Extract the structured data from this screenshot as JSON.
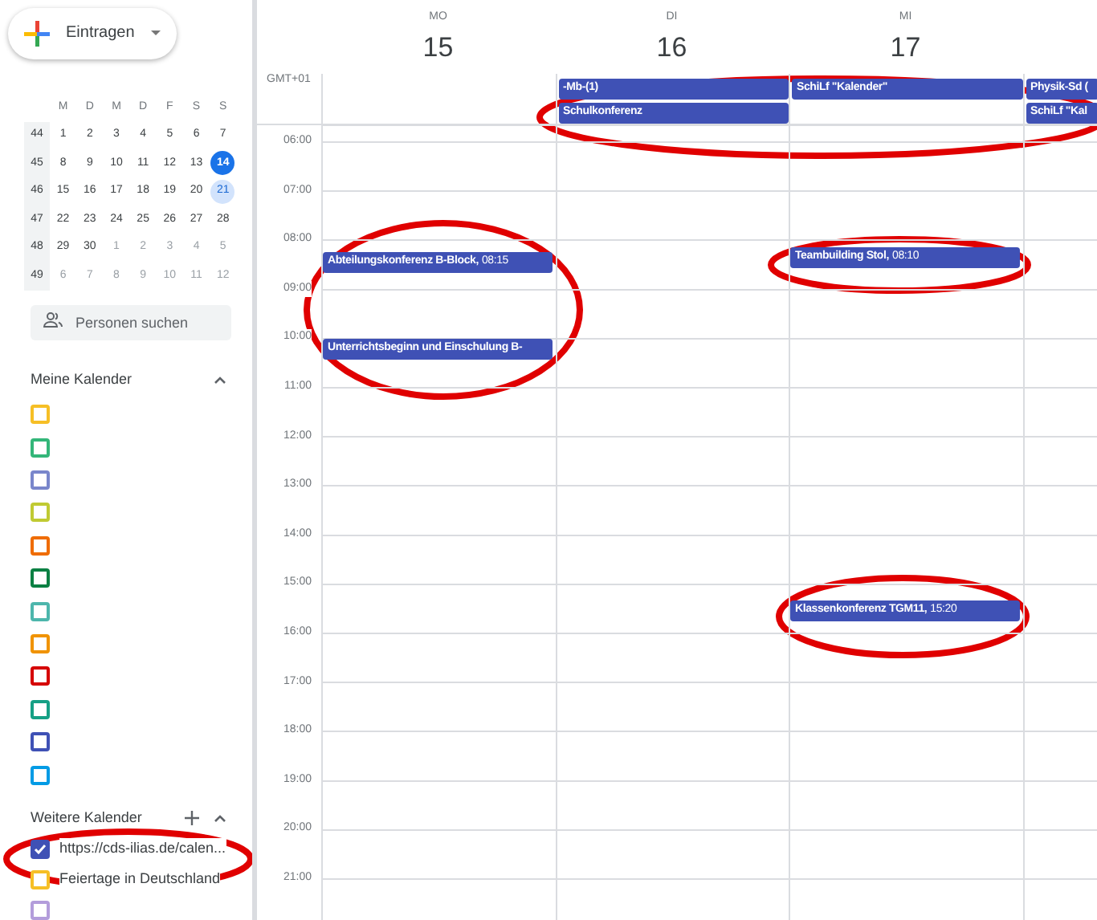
{
  "create_button": {
    "label": "Eintragen"
  },
  "mini_calendar": {
    "weekdays": [
      "M",
      "D",
      "M",
      "D",
      "F",
      "S",
      "S"
    ],
    "weeks": [
      {
        "number": "44",
        "days": [
          {
            "label": "1",
            "kind": "current"
          },
          {
            "label": "2",
            "kind": "current"
          },
          {
            "label": "3",
            "kind": "current"
          },
          {
            "label": "4",
            "kind": "current"
          },
          {
            "label": "5",
            "kind": "current"
          },
          {
            "label": "6",
            "kind": "current"
          },
          {
            "label": "7",
            "kind": "current"
          }
        ]
      },
      {
        "number": "45",
        "days": [
          {
            "label": "8",
            "kind": "current"
          },
          {
            "label": "9",
            "kind": "current"
          },
          {
            "label": "10",
            "kind": "current"
          },
          {
            "label": "11",
            "kind": "current"
          },
          {
            "label": "12",
            "kind": "current"
          },
          {
            "label": "13",
            "kind": "current"
          },
          {
            "label": "14",
            "kind": "today"
          }
        ]
      },
      {
        "number": "46",
        "days": [
          {
            "label": "15",
            "kind": "current"
          },
          {
            "label": "16",
            "kind": "current"
          },
          {
            "label": "17",
            "kind": "current"
          },
          {
            "label": "18",
            "kind": "current"
          },
          {
            "label": "19",
            "kind": "current"
          },
          {
            "label": "20",
            "kind": "current"
          },
          {
            "label": "21",
            "kind": "selected"
          }
        ]
      },
      {
        "number": "47",
        "days": [
          {
            "label": "22",
            "kind": "current"
          },
          {
            "label": "23",
            "kind": "current"
          },
          {
            "label": "24",
            "kind": "current"
          },
          {
            "label": "25",
            "kind": "current"
          },
          {
            "label": "26",
            "kind": "current"
          },
          {
            "label": "27",
            "kind": "current"
          },
          {
            "label": "28",
            "kind": "current"
          }
        ]
      },
      {
        "number": "48",
        "days": [
          {
            "label": "29",
            "kind": "current"
          },
          {
            "label": "30",
            "kind": "current"
          },
          {
            "label": "1",
            "kind": "other"
          },
          {
            "label": "2",
            "kind": "other"
          },
          {
            "label": "3",
            "kind": "other"
          },
          {
            "label": "4",
            "kind": "other"
          },
          {
            "label": "5",
            "kind": "other"
          }
        ]
      },
      {
        "number": "49",
        "days": [
          {
            "label": "6",
            "kind": "other"
          },
          {
            "label": "7",
            "kind": "other"
          },
          {
            "label": "8",
            "kind": "other"
          },
          {
            "label": "9",
            "kind": "other"
          },
          {
            "label": "10",
            "kind": "other"
          },
          {
            "label": "11",
            "kind": "other"
          },
          {
            "label": "12",
            "kind": "other"
          }
        ]
      }
    ]
  },
  "people_search": {
    "placeholder": "Personen suchen"
  },
  "my_calendars": {
    "title": "Meine Kalender",
    "items": [
      {
        "checked": false,
        "color": "#f6bf26"
      },
      {
        "checked": false,
        "color": "#33b679"
      },
      {
        "checked": false,
        "color": "#7986cb"
      },
      {
        "checked": false,
        "color": "#c0ca33"
      },
      {
        "checked": false,
        "color": "#ef6c00"
      },
      {
        "checked": false,
        "color": "#0b8043"
      },
      {
        "checked": false,
        "color": "#4db6ac"
      },
      {
        "checked": false,
        "color": "#f09300"
      },
      {
        "checked": false,
        "color": "#d50000"
      },
      {
        "checked": false,
        "color": "#16a085"
      },
      {
        "checked": false,
        "color": "#3f51b5"
      },
      {
        "checked": false,
        "color": "#039be5"
      }
    ]
  },
  "other_calendars": {
    "title": "Weitere Kalender",
    "items": [
      {
        "label": "https://cds-ilias.de/calen...",
        "checked": true,
        "color": "#3f51b5"
      },
      {
        "label": "Feiertage in Deutschland",
        "checked": false,
        "color": "#f6bf26"
      },
      {
        "checked": false,
        "color": "#b39ddb"
      }
    ]
  },
  "timezone": "GMT+01",
  "hours": [
    "06:00",
    "07:00",
    "08:00",
    "09:00",
    "10:00",
    "11:00",
    "12:00",
    "13:00",
    "14:00",
    "15:00",
    "16:00",
    "17:00",
    "18:00",
    "19:00",
    "20:00",
    "21:00"
  ],
  "days": [
    {
      "name": "MO",
      "number": "15",
      "events": [
        {
          "title": "Abteilungskonferenz B-Block,",
          "time": "08:15"
        },
        {
          "title": "Unterrichtsbeginn und Einschulung B-"
        }
      ]
    },
    {
      "name": "DI",
      "number": "16",
      "all_day_events": [
        {
          "title": "-Mb-(1)"
        },
        {
          "title": "Schulkonferenz"
        }
      ]
    },
    {
      "name": "MI",
      "number": "17",
      "all_day_events": [
        {
          "title": "SchiLf \"Kalender\""
        }
      ],
      "events": [
        {
          "title": "Teambuilding Stol,",
          "time": "08:10"
        },
        {
          "title": "Klassenkonferenz TGM11,",
          "time": "15:20"
        }
      ]
    },
    {
      "all_day_events": [
        {
          "title": "Physik-Sd ("
        },
        {
          "title": "SchiLf \"Kal"
        }
      ]
    }
  ]
}
